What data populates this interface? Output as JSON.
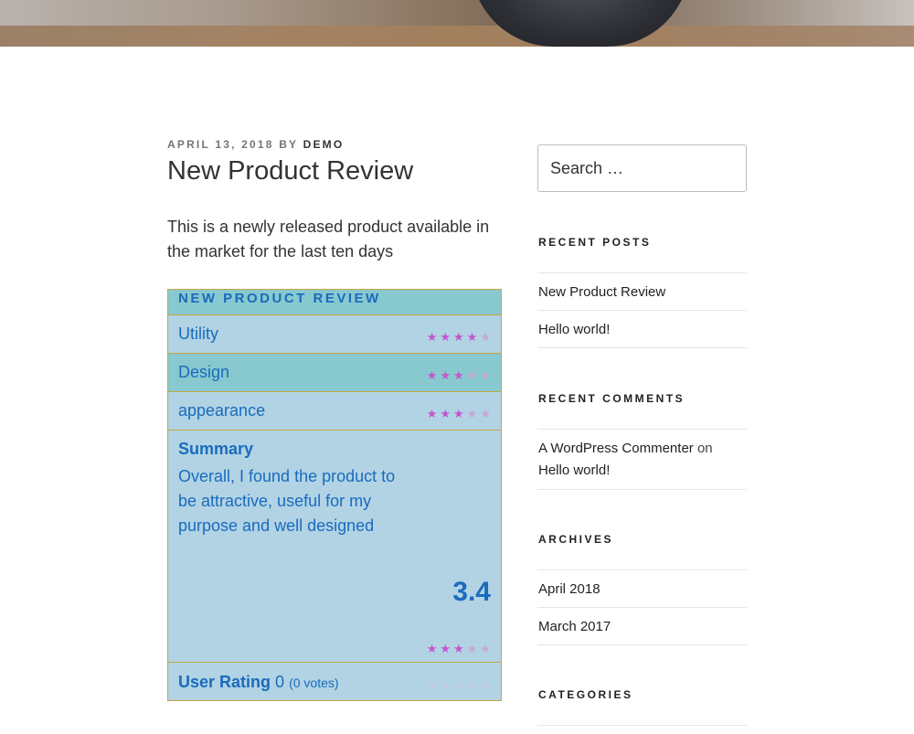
{
  "post": {
    "date": "APRIL 13, 2018",
    "by": "BY",
    "author": "DEMO",
    "title": "New Product Review",
    "intro": "This is a newly released product available in the market for the last ten days"
  },
  "review": {
    "title": "NEW PRODUCT REVIEW",
    "criteria": [
      {
        "label": "Utility",
        "rating": 4.5
      },
      {
        "label": "Design",
        "rating": 3
      },
      {
        "label": "appearance",
        "rating": 3
      }
    ],
    "summary_heading": "Summary",
    "summary_text": "Overall, I found the product to be attractive, useful for my purpose and well designed",
    "score": "3.4",
    "score_rating": 3.4,
    "user_rating_label": "User Rating",
    "user_rating_value": "0",
    "user_rating_votes": "(0 votes)",
    "star_colors": {
      "filled": "#c455cc",
      "partial": "#c8a5d8",
      "empty": "#c5c9e8"
    }
  },
  "sidebar": {
    "search_placeholder": "Search …",
    "recent_posts_title": "RECENT POSTS",
    "recent_posts": [
      "New Product Review",
      "Hello world!"
    ],
    "recent_comments_title": "RECENT COMMENTS",
    "recent_comment": {
      "author": "A WordPress Commenter",
      "on": "on",
      "post": "Hello world!"
    },
    "archives_title": "ARCHIVES",
    "archives": [
      "April 2018",
      "March 2017"
    ],
    "categories_title": "CATEGORIES"
  },
  "colors": {
    "accent_blue": "#1a6bbd",
    "review_bg": "#b1d3e4",
    "review_alt_bg": "#88c9cf",
    "border_gold": "#c7a640"
  }
}
